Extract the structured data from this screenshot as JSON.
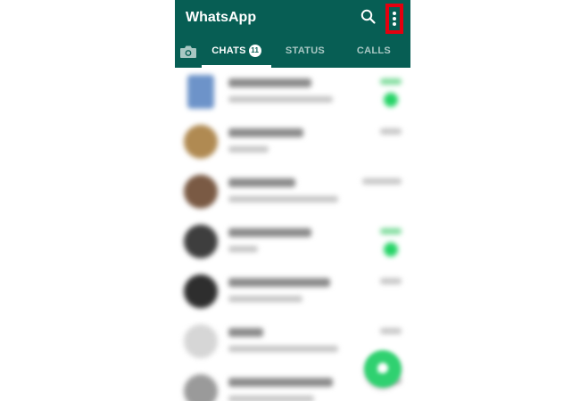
{
  "app": {
    "title": "WhatsApp",
    "brand_color": "#075e54",
    "accent_color": "#25d366",
    "highlight_color": "#e4000f"
  },
  "toolbar": {
    "search_icon": "search-icon",
    "more_icon": "more-vertical-icon"
  },
  "tabs": {
    "camera_icon": "camera-icon",
    "items": [
      {
        "label": "CHATS",
        "badge": "11",
        "active": true
      },
      {
        "label": "STATUS",
        "active": false
      },
      {
        "label": "CALLS",
        "active": false
      }
    ]
  },
  "chat_list": {
    "rows": [
      {
        "avatar": "#6d93c9",
        "name_width": 0.62,
        "preview_width": 0.78,
        "time_color": "#7fdc9c",
        "unread": true,
        "square": true
      },
      {
        "avatar": "#b08a52",
        "name_width": 0.56,
        "preview_width": 0.3,
        "time_color": "#c6c6c6",
        "unread": false
      },
      {
        "avatar": "#7a5a44",
        "name_width": 0.5,
        "preview_width": 0.82,
        "time_color": "#c6c6c6",
        "unread": false
      },
      {
        "avatar": "#3e3e3e",
        "name_width": 0.62,
        "preview_width": 0.22,
        "time_color": "#7fdc9c",
        "unread": true
      },
      {
        "avatar": "#2e2e2e",
        "name_width": 0.76,
        "preview_width": 0.55,
        "time_color": "#c6c6c6",
        "unread": false
      },
      {
        "avatar": "#d6d6d6",
        "name_width": 0.26,
        "preview_width": 0.82,
        "time_color": "#c6c6c6",
        "unread": false
      },
      {
        "avatar": "#9a9a9a",
        "name_width": 0.78,
        "preview_width": 0.64,
        "time_color": "#c6c6c6",
        "unread": false
      }
    ]
  },
  "fab": {
    "icon": "chat-icon"
  }
}
